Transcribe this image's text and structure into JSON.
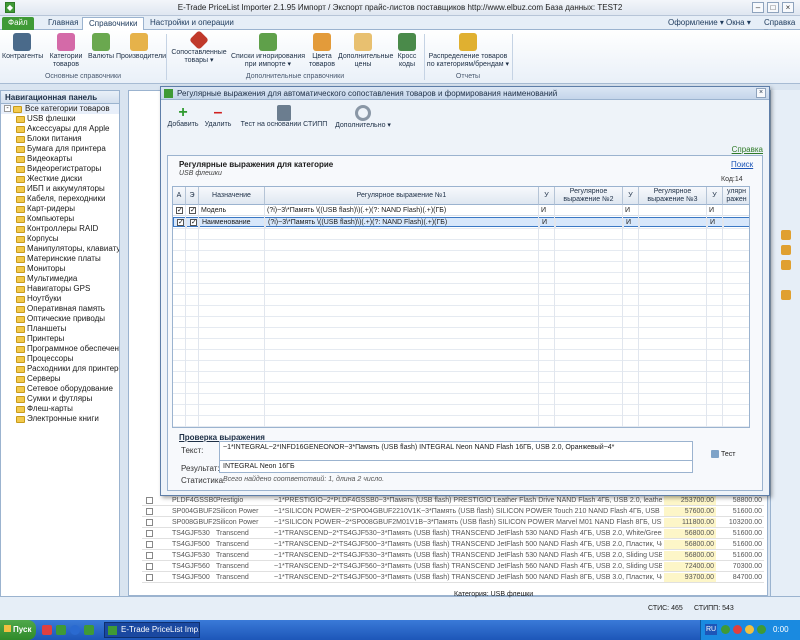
{
  "window": {
    "title": "E-Trade PriceList Importer 2.1.95      Импорт / Экспорт прайс-листов поставщиков     http://www.elbuz.com     База данных: TEST2"
  },
  "ribbon_tabs": [
    "Файл",
    "Главная",
    "Справочники",
    "Настройки и операции"
  ],
  "ribbon_right": {
    "design": "Оформление ▾",
    "windows": "Окна ▾",
    "help": "Справка ▾"
  },
  "ribbon": {
    "buttons": [
      {
        "label": "Контрагенты",
        "icon": "contractors-icon",
        "color": "#4a6a8a"
      },
      {
        "label": "Категории товаров",
        "icon": "categories-icon",
        "color": "#d46aa8"
      },
      {
        "label": "Валюты",
        "icon": "currency-icon",
        "color": "#6aa84f"
      },
      {
        "label": "Производители",
        "icon": "manufacturers-icon",
        "color": "#e6b24a"
      },
      {
        "label": "Сопоставленные товары ▾",
        "icon": "matched-goods-icon",
        "color": "#c0392b"
      },
      {
        "label": "Списки игнорирования при импорте ▾",
        "icon": "ignore-list-icon",
        "color": "#5fa04a"
      },
      {
        "label": "Цвета товаров",
        "icon": "colors-icon",
        "color": "#e39b3a"
      },
      {
        "label": "Дополнительные цены",
        "icon": "extra-prices-icon",
        "color": "#e8c070"
      },
      {
        "label": "Кросс коды",
        "icon": "cross-codes-icon",
        "color": "#4a8a4a"
      },
      {
        "label": "Распределение товаров по категориям/брендам ▾",
        "icon": "distribution-icon",
        "color": "#e0b030"
      }
    ],
    "groups": [
      "Основные справочники",
      "Дополнительные справочники",
      "Отчеты"
    ]
  },
  "nav": {
    "title": "Навигационная панель",
    "root": "Все категории товаров",
    "items": [
      "USB флешки",
      "Аксессуары для Apple",
      "Блоки питания",
      "Бумага для принтера",
      "Видеокарты",
      "Видеорегистраторы",
      "Жесткие диски",
      "ИБП и аккумуляторы",
      "Кабеля, переходники",
      "Карт-ридеры",
      "Компьютеры",
      "Контроллеры RAID",
      "Корпусы",
      "Манипуляторы, клавиатуры",
      "Материнские платы",
      "Мониторы",
      "Мультимедиа",
      "Навигаторы GPS",
      "Ноутбуки",
      "Оперативная память",
      "Оптические приводы",
      "Планшеты",
      "Принтеры",
      "Программное обеспечение",
      "Процессоры",
      "Расходники для принтеров",
      "Серверы",
      "Сетевое оборудование",
      "Сумки и футляры",
      "Флеш-карты",
      "Электронные книги"
    ]
  },
  "dialog": {
    "title": "Регулярные выражения для автоматического сопоставления товаров и формирования наименований",
    "toolbar": {
      "add": "Добавить",
      "delete": "Удалить",
      "test": "Тест на основании СТИПП",
      "extra": "Дополнительно ▾"
    },
    "help_link": "Справка",
    "section_title": "Регулярные выражения для категорие",
    "section_sub": "USB флешки",
    "search_link": "Поиск",
    "code": "Код:14",
    "columns": [
      "А",
      "Э",
      "Назначение",
      "Регулярное выражение №1",
      "У",
      "Регулярное выражение №2",
      "У",
      "Регулярное выражение №3",
      "У",
      "улярн ражен"
    ],
    "rows": [
      {
        "active": true,
        "export": true,
        "purpose": "Модель",
        "re1": "(?i)~3\\*Память \\((USB flash)\\)(.+)(?: NAND Flash)(.+)(ГБ)",
        "u1": "И",
        "re2": "",
        "u2": "И",
        "re3": "",
        "u3": "И",
        "re4": ""
      },
      {
        "active": true,
        "export": true,
        "purpose": "Наименование",
        "re1": "(?i)~3\\*Память \\((USB flash)\\)(.+)(?: NAND Flash)(.+)(ГБ)",
        "u1": "И",
        "re2": "",
        "u2": "И",
        "re3": "",
        "u3": "И",
        "re4": ""
      }
    ],
    "check": {
      "title": "Проверка выражения",
      "text_label": "Текст:",
      "text_value": "~1*INTEGRAL~2*INFD16GENEONOR~3*Память (USB flash) INTEGRAL Neon NAND Flash 16ГБ, USB 2.0, Оранжевый~4*",
      "result_label": "Результат:",
      "result_value": "INTEGRAL Neon 16ГБ",
      "stats_label": "Статистика:",
      "stats_value": "Всего найдено соответствий: 1, длина 2 число.",
      "test_button": "Тест"
    }
  },
  "bg_rows": [
    {
      "code": "PLDF4GSSB0",
      "vendor": "Prestigio",
      "desc": "~1*PRESTIGIO~2*PLDF4GSSB0~3*Память (USB flash) PRESTIGIO Leather Flash Drive NAND Flash 4ГБ, USB 2.0, leather",
      "p1": "253700.00",
      "p2": "58800.00"
    },
    {
      "code": "SP004GBUF2",
      "vendor": "Silicon Power",
      "desc": "~1*SILICON POWER~2*SP004GBUF2210V1K~3*Память (USB flash) SILICON POWER Touch 210 NAND Flash 4ГБ, USB 2.0, Slid",
      "p1": "57600.00",
      "p2": "51600.00"
    },
    {
      "code": "SP008GBUF2",
      "vendor": "Silicon Power",
      "desc": "~1*SILICON POWER~2*SP008GBUF2M01V1B~3*Память (USB flash) SILICON POWER Marvel M01 NAND Flash 8ГБ, USB 3.0, Синий",
      "p1": "111800.00",
      "p2": "103200.00"
    },
    {
      "code": "TS4GJF530",
      "vendor": "Transcend",
      "desc": "~1*TRANSCEND~2*TS4GJF530~3*Память (USB flash) TRANSCEND JetFlash 530 NAND Flash 4ГБ, USB 2.0, White/Green~4*",
      "p1": "56800.00",
      "p2": "51600.00"
    },
    {
      "code": "TS4GJF500",
      "vendor": "Transcend",
      "desc": "~1*TRANSCEND~2*TS4GJF500~3*Память (USB flash) TRANSCEND JetFlash 500 NAND Flash 4ГБ, USB 2.0, Пластик, Черный",
      "p1": "56800.00",
      "p2": "51600.00"
    },
    {
      "code": "TS4GJF530",
      "vendor": "Transcend",
      "desc": "~1*TRANSCEND~2*TS4GJF530~3*Память (USB flash) TRANSCEND JetFlash 530 NAND Flash 4ГБ, USB 2.0, Sliding USB connect",
      "p1": "56800.00",
      "p2": "51600.00"
    },
    {
      "code": "TS4GJF560",
      "vendor": "Transcend",
      "desc": "~1*TRANSCEND~2*TS4GJF560~3*Память (USB flash) TRANSCEND JetFlash 560 NAND Flash 4ГБ, USB 2.0, Sliding USB connect",
      "p1": "72400.00",
      "p2": "70300.00"
    },
    {
      "code": "TS4GJF500",
      "vendor": "Transcend",
      "desc": "~1*TRANSCEND~2*TS4GJF500~3*Память (USB flash) TRANSCEND JetFlash 500 NAND Flash 8ГБ, USB 3.0, Пластик, Черный",
      "p1": "93700.00",
      "p2": "84700.00"
    }
  ],
  "status": {
    "category": "Категория: USB флешки",
    "stic": "СТИС: 465",
    "stipp": "СТИПП: 543"
  },
  "taskbar": {
    "start": "Пуск",
    "app": "E-Trade PriceList Imp...",
    "lang": "RU",
    "time": "0:00"
  },
  "colors": {
    "accent": "#3f9a36",
    "brand": "#1d56b8",
    "selection": "#d7e7fb"
  }
}
